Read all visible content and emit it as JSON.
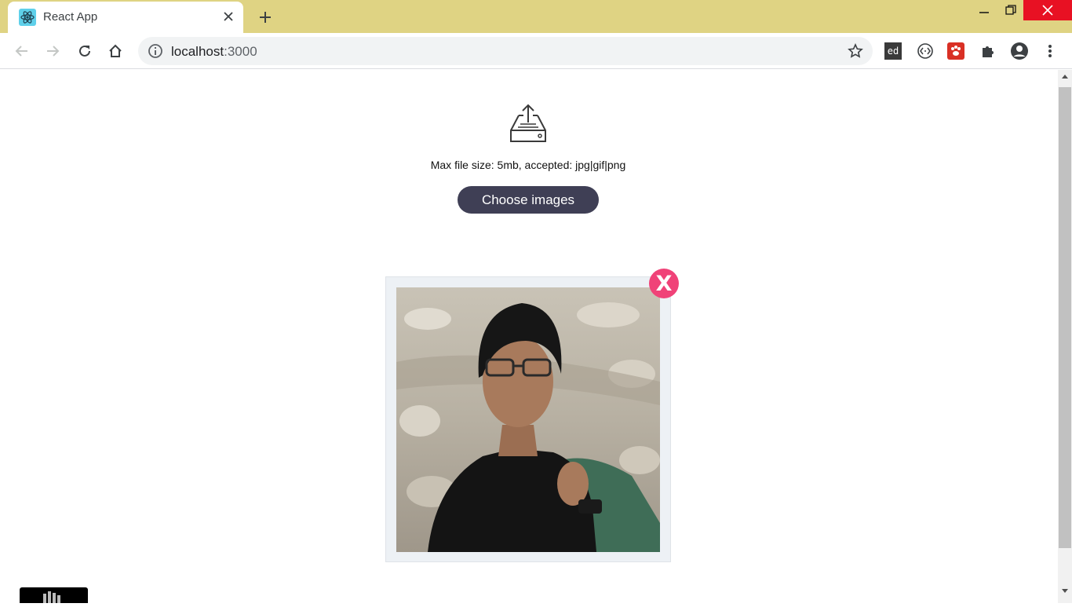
{
  "browser": {
    "tab_title": "React App",
    "url_host": "localhost",
    "url_port": ":3000",
    "extensions": [
      "ed-extension-icon",
      "code-extension-icon",
      "paw-extension-icon",
      "puzzle-icon",
      "profile-icon",
      "menu-icon"
    ],
    "ext_ed_label": "ed"
  },
  "uploader": {
    "hint": "Max file size: 5mb, accepted: jpg|gif|png",
    "button_label": "Choose images",
    "remove_label": "X"
  },
  "colors": {
    "tabstrip": "#dfd383",
    "button": "#3f3f55",
    "remove": "#f04278"
  }
}
